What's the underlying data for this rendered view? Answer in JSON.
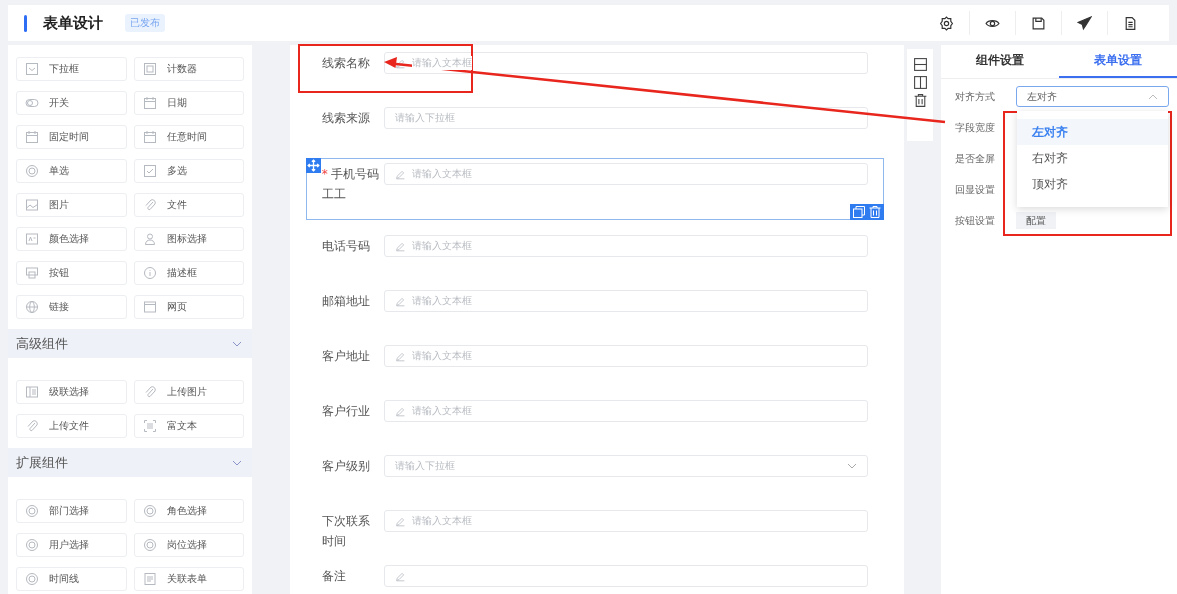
{
  "header": {
    "title": "表单设计",
    "status": "已发布"
  },
  "palette": [
    {
      "items": [
        "下拉框",
        "计数器",
        "开关",
        "日期",
        "固定时间",
        "任意时间",
        "单选",
        "多选",
        "图片",
        "文件",
        "颜色选择",
        "图标选择",
        "按钮",
        "描述框",
        "链接",
        "网页"
      ]
    },
    {
      "title": "高级组件",
      "expanded": true,
      "items": [
        "级联选择",
        "上传图片",
        "上传文件",
        "富文本"
      ]
    },
    {
      "title": "扩展组件",
      "expanded": true,
      "items": [
        "部门选择",
        "角色选择",
        "用户选择",
        "岗位选择",
        "时间线",
        "关联表单"
      ]
    }
  ],
  "form_fields": [
    {
      "label": "线索名称",
      "kind": "text",
      "placeholder": "请输入文本框",
      "selected": false
    },
    {
      "label": "线索来源",
      "kind": "select_bare",
      "placeholder": "请输入下拉框",
      "selected": false
    },
    {
      "label": "手机号码",
      "kind": "text",
      "placeholder": "请输入文本框",
      "required_mark": "*",
      "selected": true,
      "note": "工工"
    },
    {
      "label": "电话号码",
      "kind": "text",
      "placeholder": "请输入文本框",
      "selected": false
    },
    {
      "label": "邮箱地址",
      "kind": "text",
      "placeholder": "请输入文本框",
      "selected": false
    },
    {
      "label": "客户地址",
      "kind": "text",
      "placeholder": "请输入文本框",
      "selected": false
    },
    {
      "label": "客户行业",
      "kind": "text",
      "placeholder": "请输入文本框",
      "selected": false
    },
    {
      "label": "客户级别",
      "kind": "select",
      "placeholder": "请输入下拉框",
      "selected": false
    },
    {
      "label": "下次联系时间",
      "kind": "text",
      "placeholder": "请输入文本框",
      "selected": false
    },
    {
      "label": "备注",
      "kind": "text",
      "selected": false
    }
  ],
  "settings": {
    "tabs": [
      {
        "label": "组件设置",
        "selected": false
      },
      {
        "label": "表单设置",
        "selected": true
      }
    ],
    "rows": [
      {
        "label": "对齐方式",
        "kind": "select",
        "value": "左对齐",
        "expanded": true,
        "options": [
          {
            "label": "左对齐",
            "selected": true
          },
          {
            "label": "右对齐",
            "selected": false
          },
          {
            "label": "顶对齐",
            "selected": false
          }
        ]
      },
      {
        "label": "字段宽度",
        "kind": "blank"
      },
      {
        "label": "是否全屏",
        "kind": "blank"
      },
      {
        "label": "回显设置",
        "kind": "blank"
      },
      {
        "label": "按钮设置",
        "kind": "button",
        "value": "配置"
      }
    ]
  }
}
